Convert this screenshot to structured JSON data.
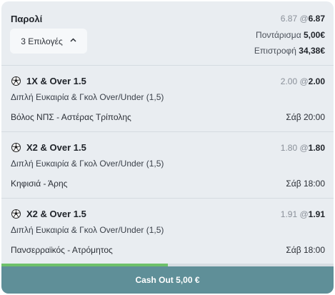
{
  "bet": {
    "title": "Παρολί",
    "odds_old": "6.87",
    "odds_sep": " @",
    "odds_new": "6.87",
    "selections_label": "3 Επιλογές",
    "stake_label": "Ποντάρισμα ",
    "stake_value": "5,00€",
    "return_label": "Επιστροφή ",
    "return_value": "34,38€"
  },
  "legs": [
    {
      "selection": "1X & Over 1.5",
      "odds_old": "2.00",
      "odds_sep": " @",
      "odds_new": "2.00",
      "market": "Διπλή Ευκαιρία & Γκολ Over/Under (1,5)",
      "match": "Βόλος ΝΠΣ - Αστέρας Τρίπολης",
      "time": "Σάβ 20:00",
      "icon": "soccer-ball-icon"
    },
    {
      "selection": "X2 & Over 1.5",
      "odds_old": "1.80",
      "odds_sep": " @",
      "odds_new": "1.80",
      "market": "Διπλή Ευκαιρία & Γκολ Over/Under (1,5)",
      "match": "Κηφισιά - Άρης",
      "time": "Σάβ 18:00",
      "icon": "soccer-ball-icon"
    },
    {
      "selection": "X2 & Over 1.5",
      "odds_old": "1.91",
      "odds_sep": " @",
      "odds_new": "1.91",
      "market": "Διπλή Ευκαιρία & Γκολ Over/Under (1,5)",
      "match": "Πανσερραϊκός - Ατρόμητος",
      "time": "Σάβ 18:00",
      "icon": "soccer-ball-icon"
    }
  ],
  "cashout": {
    "label": "Cash Out 5,00 €",
    "progress_fraction": 0.5
  },
  "colors": {
    "card_bg": "#e9edf1",
    "cashout_bg": "#5f8f98",
    "progress": "#6ec06a"
  }
}
